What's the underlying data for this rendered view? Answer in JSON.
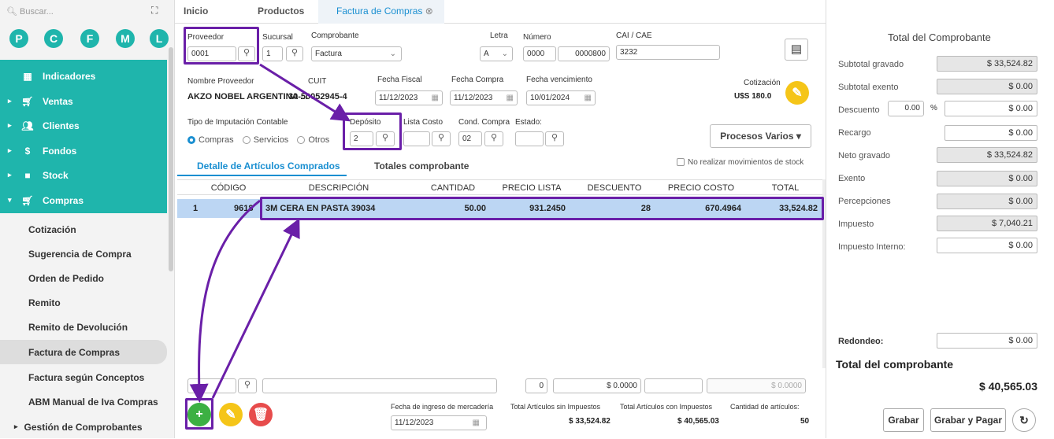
{
  "sidebar": {
    "search_placeholder": "Buscar...",
    "circles": [
      "P",
      "C",
      "F",
      "M",
      "L"
    ],
    "nav": [
      {
        "label": "Indicadores",
        "icon": "grid-icon",
        "arrow": ""
      },
      {
        "label": "Ventas",
        "icon": "cart-icon",
        "arrow": "▸"
      },
      {
        "label": "Clientes",
        "icon": "users-icon",
        "arrow": "▸"
      },
      {
        "label": "Fondos",
        "icon": "dollar-icon",
        "arrow": "▸"
      },
      {
        "label": "Stock",
        "icon": "box-icon",
        "arrow": "▸"
      },
      {
        "label": "Compras",
        "icon": "basket-icon",
        "arrow": "▾"
      }
    ],
    "sub": [
      "Cotización",
      "Sugerencia de Compra",
      "Orden de Pedido",
      "Remito",
      "Remito de Devolución",
      "Factura de Compras",
      "Factura según Conceptos",
      "ABM Manual de Iva Compras"
    ],
    "gestion": "Gestión de Comprobantes"
  },
  "tabs": [
    "Inicio",
    "Productos",
    "Factura de Compras"
  ],
  "form": {
    "proveedor_label": "Proveedor",
    "proveedor": "0001",
    "sucursal_label": "Sucursal",
    "sucursal": "1",
    "comprobante_label": "Comprobante",
    "comprobante": "Factura",
    "letra_label": "Letra",
    "letra": "A",
    "numero_label": "Número",
    "numero1": "0000",
    "numero2": "0000800",
    "cai_label": "CAI / CAE",
    "cai": "3232",
    "nombre_label": "Nombre Proveedor",
    "nombre": "AKZO NOBEL ARGENTINA ...",
    "cuit_label": "CUIT",
    "cuit": "30-50052945-4",
    "fiscal_label": "Fecha Fiscal",
    "fiscal": "11/12/2023",
    "compra_label": "Fecha Compra",
    "compra": "11/12/2023",
    "venc_label": "Fecha vencimiento",
    "venc": "10/01/2024",
    "cot_label": "Cotización",
    "cot": "U$S 180.0",
    "imput_label": "Tipo de Imputación Contable",
    "r1": "Compras",
    "r2": "Servicios",
    "r3": "Otros",
    "deposito_label": "Depósito",
    "deposito": "2",
    "lista_label": "Lista Costo",
    "cond_label": "Cond. Compra",
    "cond": "02",
    "estado_label": "Estado:",
    "procesos": "Procesos Varios ▾",
    "tab1": "Detalle de Artículos Comprados",
    "tab2": "Totales comprobante",
    "nostock": "No realizar movimientos de stock"
  },
  "table": {
    "headers": [
      "CÓDIGO",
      "DESCRIPCIÓN",
      "CANTIDAD",
      "PRECIO LISTA",
      "DESCUENTO",
      "PRECIO COSTO",
      "TOTAL"
    ],
    "row": {
      "n": "1",
      "codigo": "9618",
      "desc": "3M CERA EN PASTA 39034",
      "cant": "50.00",
      "lista": "931.2450",
      "desc_pct": "28",
      "costo": "670.4964",
      "total": "33,524.82"
    }
  },
  "bottom": {
    "qty": "0",
    "price": "$ 0.0000",
    "price2": "$ 0.0000",
    "ingreso_label": "Fecha de ingreso de mercadería",
    "ingreso": "11/12/2023",
    "sinimp_label": "Total Artículos sin Impuestos",
    "sinimp": "$ 33,524.82",
    "conimp_label": "Total Artículos con Impuestos",
    "conimp": "$ 40,565.03",
    "cant_label": "Cantidad de artículos:",
    "cant": "50"
  },
  "totals": {
    "title": "Total del Comprobante",
    "items": [
      {
        "label": "Subtotal gravado",
        "value": "$ 33,524.82"
      },
      {
        "label": "Subtotal exento",
        "value": "$ 0.00"
      },
      {
        "label": "Descuento",
        "value": "$ 0.00",
        "pct": "0.00",
        "pct_sym": "%"
      },
      {
        "label": "Recargo",
        "value": "$ 0.00"
      },
      {
        "label": "Neto gravado",
        "value": "$ 33,524.82"
      },
      {
        "label": "Exento",
        "value": "$ 0.00"
      },
      {
        "label": "Percepciones",
        "value": "$ 0.00"
      },
      {
        "label": "Impuesto",
        "value": "$ 7,040.21"
      },
      {
        "label": "Impuesto Interno:",
        "value": "$ 0.00"
      }
    ],
    "redondeo_label": "Redondeo:",
    "redondeo": "$ 0.00",
    "total_label": "Total del comprobante",
    "total": "$ 40,565.03",
    "grabar": "Grabar",
    "grabar_pagar": "Grabar y Pagar"
  },
  "colors": {
    "teal": "#1fb5ac",
    "blue": "#1a8fd1",
    "purple": "#6a1fa8"
  }
}
